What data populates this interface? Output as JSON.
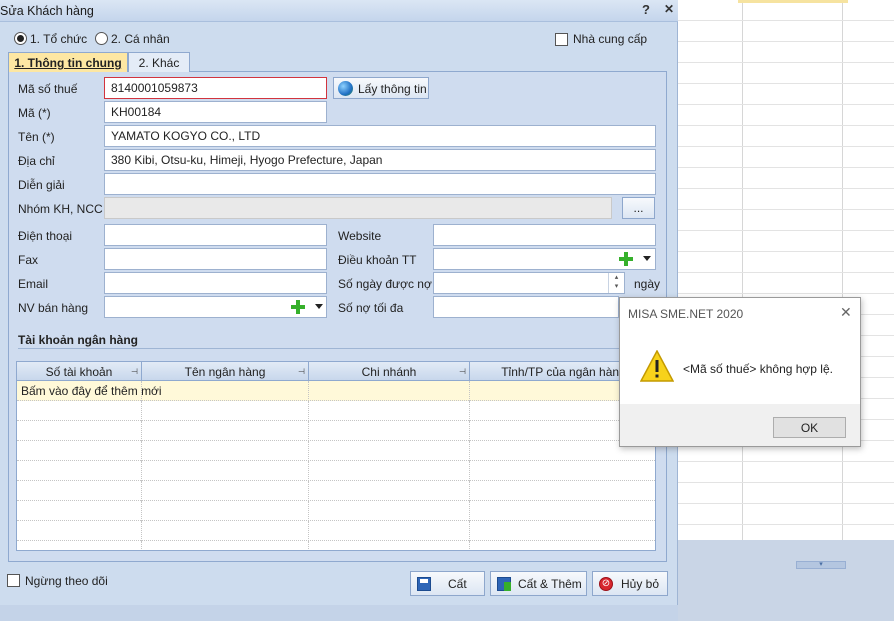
{
  "window": {
    "title": "Sửa Khách hàng",
    "help_label": "?",
    "min_label": "▾",
    "close_label": "✕"
  },
  "entity_type": {
    "options": [
      "1. Tổ chức",
      "2. Cá nhân"
    ],
    "selected": "1. Tổ chức"
  },
  "supplier_checkbox": {
    "label": "Nhà cung cấp",
    "checked": false
  },
  "tabs": [
    {
      "label": "1. Thông tin chung",
      "active": true
    },
    {
      "label": "2. Khác",
      "active": false
    }
  ],
  "form": {
    "tax_code": {
      "label": "Mã số thuế",
      "value": "8140001059873"
    },
    "fetch_button": "Lấy thông tin",
    "code": {
      "label": "Mã (*)",
      "value": "KH00184"
    },
    "name": {
      "label": "Tên (*)",
      "value": "YAMATO KOGYO CO., LTD"
    },
    "address": {
      "label": "Địa chỉ",
      "value": "380 Kibi, Otsu-ku, Himeji, Hyogo Prefecture, Japan"
    },
    "description": {
      "label": "Diễn giải",
      "value": ""
    },
    "group": {
      "label": "Nhóm KH, NCC",
      "value": "",
      "browse_label": "..."
    },
    "phone": {
      "label": "Điện thoại",
      "value": ""
    },
    "fax": {
      "label": "Fax",
      "value": ""
    },
    "email": {
      "label": "Email",
      "value": ""
    },
    "sales_staff": {
      "label": "NV bán hàng",
      "value": ""
    },
    "website": {
      "label": "Website",
      "value": ""
    },
    "payment_terms": {
      "label": "Điều khoản TT",
      "value": ""
    },
    "credit_days": {
      "label": "Số ngày được nợ",
      "value": "",
      "unit": "ngày"
    },
    "max_debt": {
      "label": "Số nợ tối đa",
      "value": ""
    }
  },
  "bank": {
    "title": "Tài khoản ngân hàng",
    "columns": [
      "Số tài khoản",
      "Tên ngân hàng",
      "Chi nhánh",
      "Tỉnh/TP của ngân hàng"
    ],
    "add_row_hint": "Bấm vào đây để thêm mới"
  },
  "inactive_checkbox": {
    "label": "Ngừng theo dõi",
    "checked": false
  },
  "footer": {
    "save": "Cất",
    "save_add": "Cất & Thêm",
    "cancel": "Hủy bỏ"
  },
  "message_box": {
    "title": "MISA SME.NET 2020",
    "close_label": "✕",
    "message": "<Mã số thuế> không hợp lệ.",
    "ok": "OK",
    "icon": "warning-icon"
  },
  "colors": {
    "error_border": "#d2343e",
    "active_tab": "#fde7a3",
    "dialog_bg": "#cddcee"
  }
}
